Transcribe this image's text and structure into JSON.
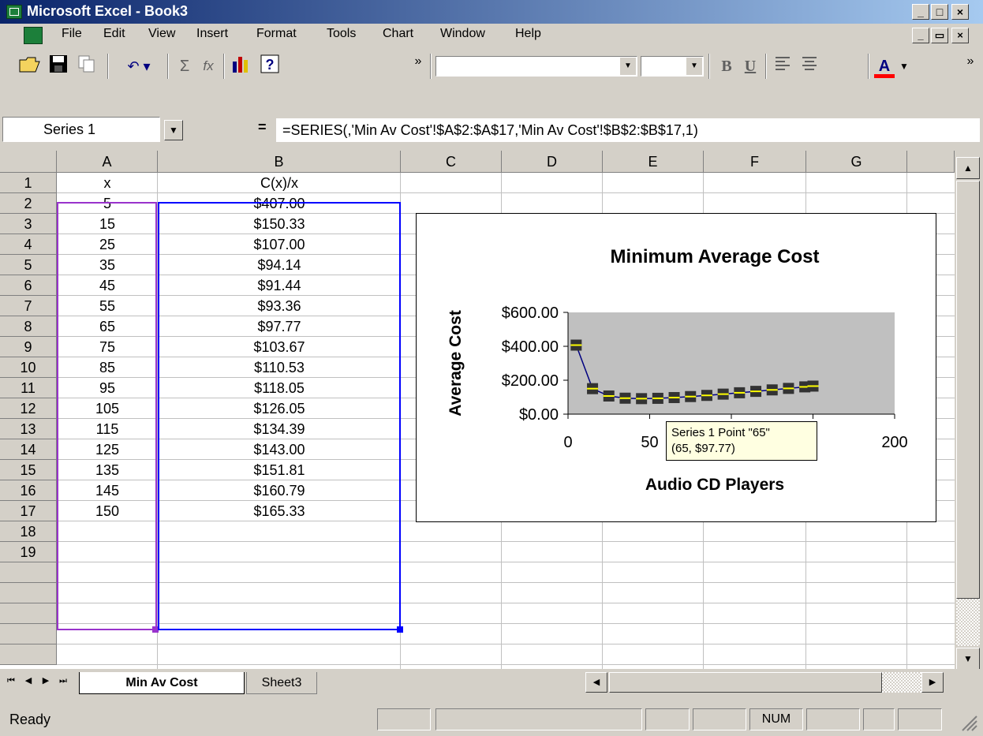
{
  "window": {
    "title": "Microsoft Excel - Book3",
    "min_glyph": "_",
    "max_glyph": "□",
    "close_glyph": "×",
    "restore_glyph": "▭"
  },
  "menu": {
    "items": [
      "File",
      "Edit",
      "View",
      "Insert",
      "Format",
      "Tools",
      "Chart",
      "Window",
      "Help"
    ]
  },
  "toolbar": {
    "icons": [
      "open-icon",
      "save-icon",
      "copy-icon",
      "undo-icon",
      "autosum-icon",
      "function-icon",
      "chart-wizard-icon",
      "help-icon"
    ],
    "sum_glyph": "Σ",
    "fx_glyph": "fx",
    "bold_label": "B",
    "underline_label": "U",
    "font_color_label": "A",
    "overflow_glyph": "»",
    "font_color": "#ff0000"
  },
  "formula_bar": {
    "name_box": "Series 1",
    "equals": "=",
    "formula": "=SERIES(,'Min Av Cost'!$A$2:$A$17,'Min Av Cost'!$B$2:$B$17,1)"
  },
  "grid": {
    "columns": [
      "A",
      "B",
      "C",
      "D",
      "E",
      "F",
      "G"
    ],
    "rows": [
      "1",
      "2",
      "3",
      "4",
      "5",
      "6",
      "7",
      "8",
      "9",
      "10",
      "11",
      "12",
      "13",
      "14",
      "15",
      "16",
      "17",
      "18",
      "19"
    ],
    "header_a": "x",
    "header_b": "C(x)/x",
    "col_a": [
      "5",
      "15",
      "25",
      "35",
      "45",
      "55",
      "65",
      "75",
      "85",
      "95",
      "105",
      "115",
      "125",
      "135",
      "145",
      "150"
    ],
    "col_b": [
      "$407.00",
      "$150.33",
      "$107.00",
      "$94.14",
      "$91.44",
      "$93.36",
      "$97.77",
      "$103.67",
      "$110.53",
      "$118.05",
      "$126.05",
      "$134.39",
      "$143.00",
      "$151.81",
      "$160.79",
      "$165.33"
    ],
    "selection_a_color": "#9933cc",
    "selection_b_color": "#0000ff"
  },
  "chart_data": {
    "type": "scatter",
    "title": "Minimum Average Cost",
    "xlabel": "Audio CD Players",
    "ylabel": "Average Cost",
    "x": [
      5,
      15,
      25,
      35,
      45,
      55,
      65,
      75,
      85,
      95,
      105,
      115,
      125,
      135,
      145,
      150
    ],
    "series": [
      {
        "name": "Series 1",
        "values": [
          407.0,
          150.33,
          107.0,
          94.14,
          91.44,
          93.36,
          97.77,
          103.67,
          110.53,
          118.05,
          126.05,
          134.39,
          143.0,
          151.81,
          160.79,
          165.33
        ]
      }
    ],
    "xlim": [
      0,
      200
    ],
    "ylim": [
      0,
      600
    ],
    "x_ticks": [
      "0",
      "50",
      "",
      "",
      "200"
    ],
    "x_tick_values": [
      0,
      50,
      100,
      150,
      200
    ],
    "y_ticks": [
      "$0.00",
      "$200.00",
      "$400.00",
      "$600.00"
    ],
    "y_tick_values": [
      0,
      200,
      400,
      600
    ],
    "plot_bg": "#c0c0c0",
    "line_color": "#000080",
    "marker_color": "#333333",
    "marker_selected_fill": "#ffff00",
    "legend": "none",
    "grid": false
  },
  "tooltip": {
    "line1": "Series 1 Point \"65\"",
    "line2": "(65, $97.77)"
  },
  "sheet_tabs": {
    "nav": [
      "⏮",
      "◀",
      "▶",
      "⏭"
    ],
    "tabs": [
      "Min Av Cost",
      "Sheet3"
    ],
    "active": "Min Av Cost"
  },
  "status": {
    "text": "Ready",
    "num": "NUM"
  }
}
